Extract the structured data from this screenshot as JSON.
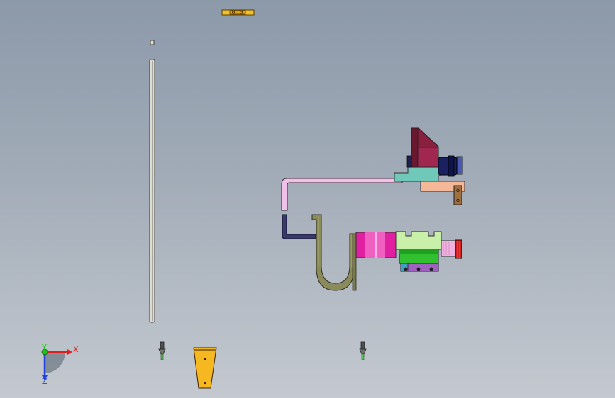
{
  "triad": {
    "x_label": "X",
    "y_label": "Y",
    "z_label": "Z",
    "x_color": "#e02020",
    "y_color": "#20c020",
    "z_color": "#2040e0"
  },
  "colors": {
    "bg_top": "#8c99a9",
    "bg_bottom": "#c4c9d0",
    "rod": "#dcdcd4",
    "pink_arm": "#f0c0e8",
    "olive_hook": "#8a8a5a",
    "maroon_bracket": "#8a2040",
    "teal_block": "#70c8b8",
    "peach_plate": "#f4b898",
    "magenta_roller": "#e020a0",
    "lightgreen_block": "#c8f0a8",
    "green_block": "#30c030",
    "navy_cylinder": "#1a2060",
    "yellow_part": "#f0b020",
    "purple_base": "#a060c0"
  }
}
